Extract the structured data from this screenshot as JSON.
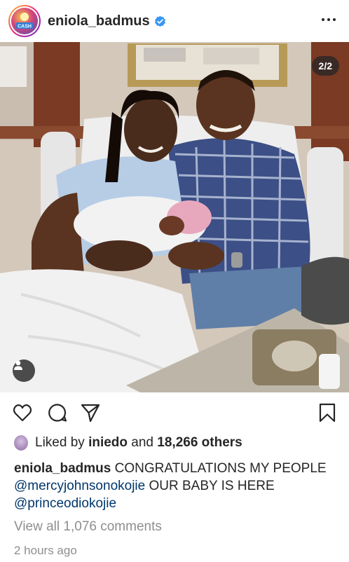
{
  "post": {
    "username": "eniola_badmus",
    "avatar_label": "CASH",
    "verified_icon": "verified-badge-icon",
    "more_icon": "more-options-icon",
    "image_counter": "2/2",
    "user_tag_icon": "tagged-user-icon"
  },
  "actions": {
    "like_icon": "heart-icon",
    "comment_icon": "comment-icon",
    "share_icon": "send-icon",
    "save_icon": "bookmark-icon"
  },
  "likes": {
    "prefix": "Liked by",
    "liker": "iniedo",
    "connector": "and",
    "others": "18,266 others"
  },
  "caption": {
    "username": "eniola_badmus",
    "text_1": "CONGRATULATIONS MY PEOPLE",
    "mention_1": "@mercyjohnsonokojie",
    "text_2": "OUR BABY IS HERE",
    "mention_2": "@princeodiokojie"
  },
  "comments_link": "View all 1,076 comments",
  "time_ago": "2 hours ago",
  "colors": {
    "text": "#262626",
    "muted": "#8e8e8e",
    "mention": "#00376b",
    "verified": "#3897f0"
  }
}
